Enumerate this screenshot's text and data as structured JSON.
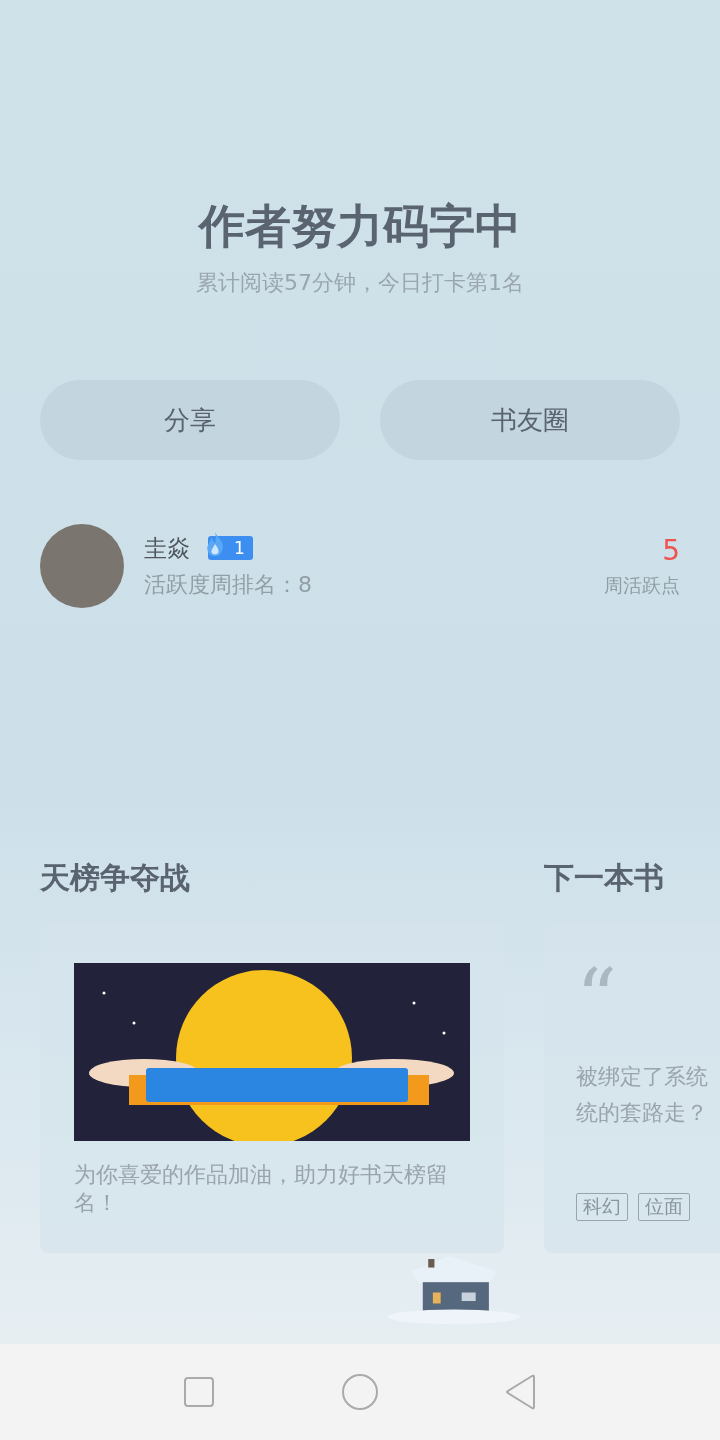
{
  "header": {
    "title": "作者努力码字中",
    "subtitle": "累计阅读57分钟，今日打卡第1名"
  },
  "actions": [
    {
      "label": "分享"
    },
    {
      "label": "书友圈"
    }
  ],
  "user": {
    "name": "圭焱",
    "badge": "1",
    "rank": "活跃度周排名：8",
    "points": "5",
    "points_label": "周活跃点"
  },
  "sections": [
    {
      "title": "天榜争夺战"
    },
    {
      "title": "下一本书"
    }
  ],
  "contest_card": {
    "description": "为你喜爱的作品加油，助力好书天榜留名！"
  },
  "book_card": {
    "quote_mark": "“",
    "lines": [
      "被绑定了系统",
      "统的套路走？"
    ],
    "tags": [
      "科幻",
      "位面"
    ]
  }
}
